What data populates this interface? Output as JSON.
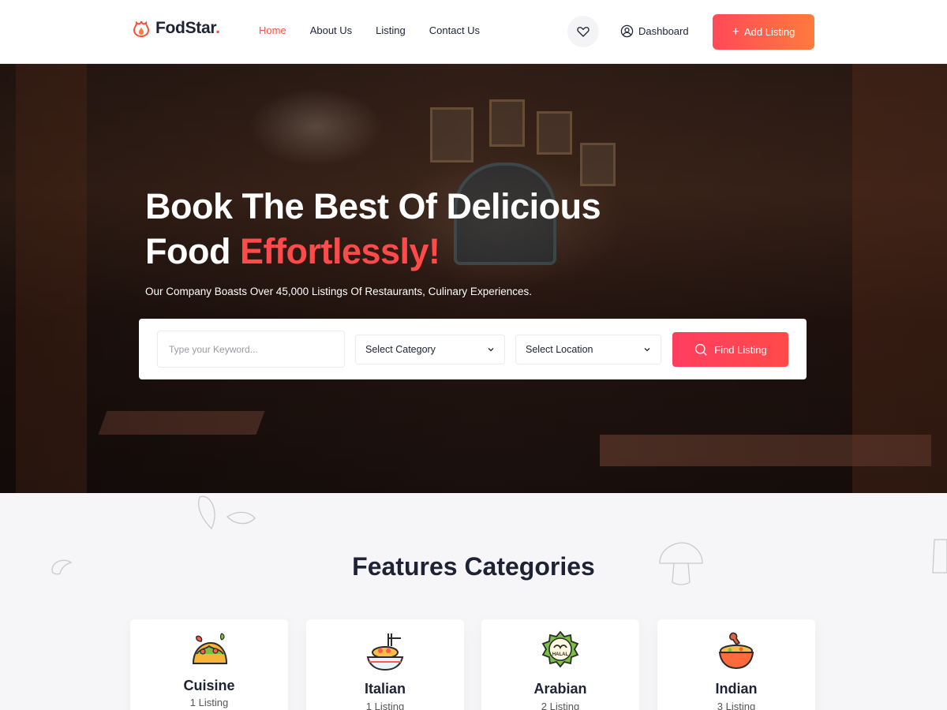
{
  "header": {
    "logo_text": "FodStar",
    "logo_dot": ".",
    "nav": [
      {
        "label": "Home",
        "active": true
      },
      {
        "label": "About Us",
        "active": false
      },
      {
        "label": "Listing",
        "active": false
      },
      {
        "label": "Contact Us",
        "active": false
      }
    ],
    "dashboard_label": "Dashboard",
    "add_listing_label": "Add Listing",
    "icons": {
      "wishlist": "heart-icon",
      "dashboard": "user-circle-icon",
      "add": "plus-icon"
    }
  },
  "hero": {
    "title_line1": "Book The Best Of Delicious",
    "title_line2_plain": "Food ",
    "title_line2_accent": "Effortlessly!",
    "subtitle": "Our Company Boasts Over 45,000 Listings Of Restaurants, Culinary Experiences."
  },
  "search": {
    "keyword_placeholder": "Type your Keyword...",
    "category_value": "Select Category",
    "location_value": "Select Location",
    "find_label": "Find Listing"
  },
  "features": {
    "title": "Features Categories",
    "categories": [
      {
        "name": "Cuisine",
        "count": "1 Listing",
        "icon": "taco-icon"
      },
      {
        "name": "Italian",
        "count": "1 Listing",
        "icon": "pasta-icon"
      },
      {
        "name": "Arabian",
        "count": "2 Listing",
        "icon": "halal-icon"
      },
      {
        "name": "Indian",
        "count": "3 Listing",
        "icon": "curry-bowl-icon"
      }
    ]
  },
  "colors": {
    "accent": "#ff4f3a",
    "dark": "#1d2235",
    "button_gradient_start": "#ff4a58",
    "button_gradient_end": "#ff7a3d"
  }
}
